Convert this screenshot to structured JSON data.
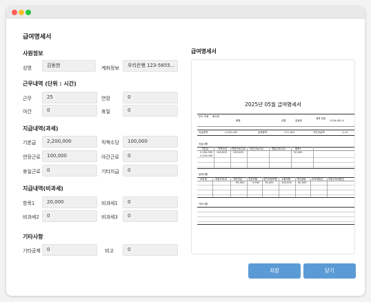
{
  "page_title": "급여명세서",
  "sections": {
    "employee": "사원정보",
    "work": "근무내역 (단위 : 시간)",
    "pay_taxable": "지급내역(과세)",
    "pay_nontaxable": "지급내역(비과세)",
    "other": "기타사항"
  },
  "employee": {
    "name_label": "성명",
    "name_value": "김동현",
    "account_label": "계좌정보",
    "account_value": "우리은행 123-5655..."
  },
  "work": {
    "work_label": "근무",
    "work_value": "25",
    "overtime_label": "연장",
    "overtime_value": "0",
    "night_label": "야간",
    "night_value": "0",
    "holiday_label": "휴일",
    "holiday_value": "0"
  },
  "pay_taxable": {
    "base_label": "기본급",
    "base_value": "2,200,000",
    "duty_label": "직책수당",
    "duty_value": "100,000",
    "ot_label": "연장근로",
    "ot_value": "100,000",
    "night_label": "야간근로",
    "night_value": "0",
    "holiday_label": "휴일근로",
    "holiday_value": "0",
    "etc_label": "기타지급",
    "etc_value": "0"
  },
  "pay_nontaxable": {
    "item1_label": "항목1",
    "item1_value": "20,000",
    "nt1_label": "비과세1",
    "nt1_value": "0",
    "nt2_label": "비과세2",
    "nt2_value": "0",
    "nt3_label": "비과세3",
    "nt3_value": "0"
  },
  "other": {
    "deduct_label": "기타공제",
    "deduct_value": "0",
    "note_label": "비고",
    "note_value": "0"
  },
  "preview": {
    "title": "급여명세서",
    "doc_title": "2025년 05월 급여명세서",
    "dept_label": "부서\n직위",
    "dept_value": "회사명",
    "company": "화원",
    "name_label": "성명",
    "name_value": "김동현",
    "account_label": "계좌\n번호",
    "account_value": "1234-902-4",
    "total_pay_label": "지급총액",
    "total_pay_value": "2,420,000",
    "total_deduct_label": "공제총액",
    "total_deduct_value": "272,160",
    "net_label": "차인지급액",
    "net_value": "2,14",
    "pay_section": "지급사항",
    "pay_headers": [
      "기본급",
      "직책수당",
      "연장근로수당",
      "야간근로수당",
      "휴일근로수당",
      "항목1"
    ],
    "pay_row1": [
      "2,200,000",
      "100,000",
      "100,000",
      "",
      "",
      "20,000"
    ],
    "pay_row2": [
      "2,420,000"
    ],
    "deduct_section": "공제사항",
    "deduct_headers": [
      "소득세",
      "지방소득세",
      "국민연금",
      "건강보험",
      "장기요양보험",
      "고용보험",
      "기타공제",
      "소득세정산",
      "지방소득세정산"
    ],
    "deduct_row1": [
      "",
      "",
      "99,000",
      "5,940",
      "78,000",
      "100,000",
      "40,000",
      "",
      ""
    ],
    "other_section": "기타사항"
  },
  "buttons": {
    "save": "저장",
    "close": "닫기"
  },
  "colors": {
    "accent": "#5b9bd5",
    "field_bg": "#f0f0f1"
  }
}
